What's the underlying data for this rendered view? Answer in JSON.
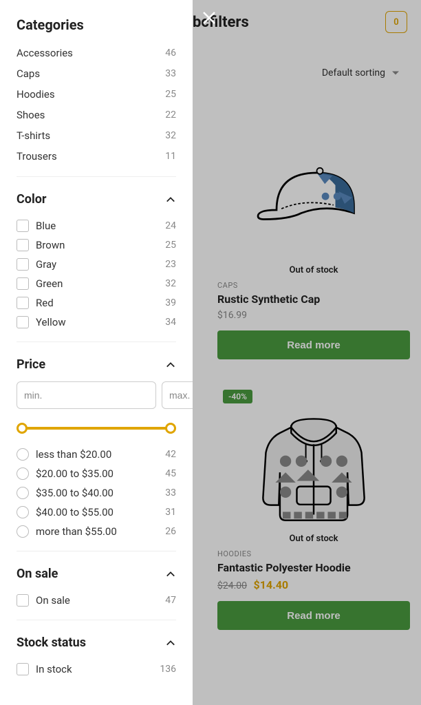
{
  "header": {
    "brand": "bcfilters",
    "cart_count": "0"
  },
  "sort": {
    "selected": "Default sorting"
  },
  "products": [
    {
      "category": "CAPS",
      "name": "Rustic Synthetic Cap",
      "price": "$16.99",
      "stock": "Out of stock",
      "button": "Read more",
      "badge": null
    },
    {
      "category": "HOODIES",
      "name": "Fantastic Polyester Hoodie",
      "price_old": "$24.00",
      "price_new": "$14.40",
      "stock": "Out of stock",
      "button": "Read more",
      "badge": "-40%"
    }
  ],
  "filters": {
    "categories_title": "Categories",
    "categories": [
      {
        "label": "Accessories",
        "count": "46"
      },
      {
        "label": "Caps",
        "count": "33"
      },
      {
        "label": "Hoodies",
        "count": "25"
      },
      {
        "label": "Shoes",
        "count": "22"
      },
      {
        "label": "T-shirts",
        "count": "32"
      },
      {
        "label": "Trousers",
        "count": "11"
      }
    ],
    "color_title": "Color",
    "colors": [
      {
        "label": "Blue",
        "count": "24"
      },
      {
        "label": "Brown",
        "count": "25"
      },
      {
        "label": "Gray",
        "count": "23"
      },
      {
        "label": "Green",
        "count": "32"
      },
      {
        "label": "Red",
        "count": "39"
      },
      {
        "label": "Yellow",
        "count": "34"
      }
    ],
    "price_title": "Price",
    "price_min_placeholder": "min.",
    "price_max_placeholder": "max.",
    "price_ranges": [
      {
        "label": "less than $20.00",
        "count": "42"
      },
      {
        "label": "$20.00 to $35.00",
        "count": "45"
      },
      {
        "label": "$35.00 to $40.00",
        "count": "33"
      },
      {
        "label": "$40.00 to $55.00",
        "count": "31"
      },
      {
        "label": "more than $55.00",
        "count": "26"
      }
    ],
    "onsale_title": "On sale",
    "onsale": [
      {
        "label": "On sale",
        "count": "47"
      }
    ],
    "stock_title": "Stock status",
    "stock": [
      {
        "label": "In stock",
        "count": "136"
      }
    ]
  }
}
